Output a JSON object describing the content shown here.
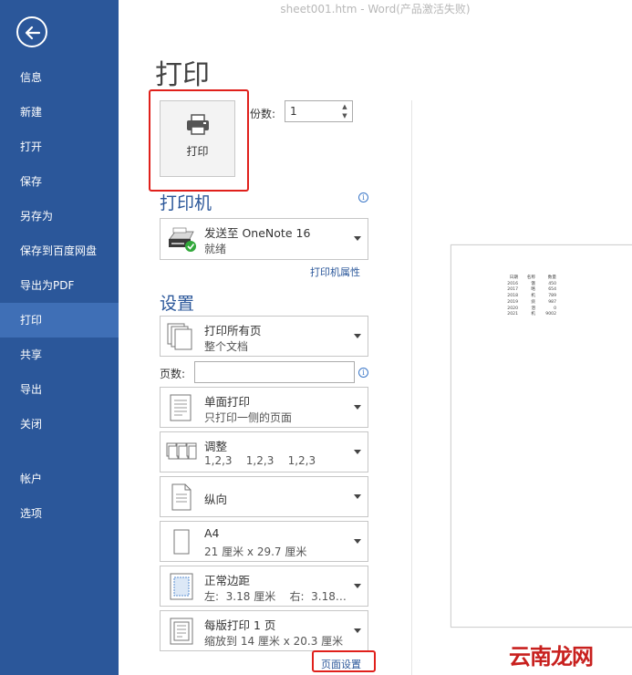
{
  "window": {
    "title": "sheet001.htm - Word(产品激活失败)"
  },
  "sidebar": {
    "items": [
      {
        "label": "信息"
      },
      {
        "label": "新建"
      },
      {
        "label": "打开"
      },
      {
        "label": "保存"
      },
      {
        "label": "另存为"
      },
      {
        "label": "保存到百度网盘"
      },
      {
        "label": "导出为PDF"
      },
      {
        "label": "打印",
        "active": true
      },
      {
        "label": "共享"
      },
      {
        "label": "导出"
      },
      {
        "label": "关闭"
      },
      {
        "label": "帐户"
      },
      {
        "label": "选项"
      }
    ]
  },
  "main": {
    "title": "打印",
    "print_button_label": "打印",
    "copies_label": "份数:",
    "copies_value": "1",
    "printer_section": "打印机",
    "printer": {
      "name": "发送至 OneNote 16",
      "status": "就绪",
      "properties_link": "打印机属性"
    },
    "settings_section": "设置",
    "settings": [
      {
        "l1": "打印所有页",
        "l2": "整个文档"
      },
      {
        "l1": "单面打印",
        "l2": "只打印一侧的页面"
      },
      {
        "l1": "调整",
        "l2": "1,2,3    1,2,3    1,2,3"
      },
      {
        "l1": "纵向",
        "l2": ""
      },
      {
        "l1": "A4",
        "l2": "21 厘米 x 29.7 厘米"
      },
      {
        "l1": "正常边距",
        "l2": "左:  3.18 厘米    右:  3.18…"
      },
      {
        "l1": "每版打印 1 页",
        "l2": "缩放到 14 厘米 x 20.3 厘米"
      }
    ],
    "pages_label": "页数:",
    "page_setup_link": "页面设置"
  },
  "preview": {
    "headers": [
      "日期",
      "名称",
      "数量"
    ],
    "rows": [
      [
        "2016",
        "饿",
        "450"
      ],
      [
        "2017",
        "略",
        "654"
      ],
      [
        "2018",
        "机",
        "789"
      ],
      [
        "2019",
        "痰",
        "987"
      ],
      [
        "2020",
        "泪",
        "0"
      ],
      [
        "2021",
        "机",
        "9002"
      ]
    ]
  },
  "watermark": "云南龙网",
  "colors": {
    "sidebar": "#2b579a",
    "sidebar_active": "#3f6fb6",
    "accent": "#2b579a",
    "highlight": "#e0201b"
  }
}
